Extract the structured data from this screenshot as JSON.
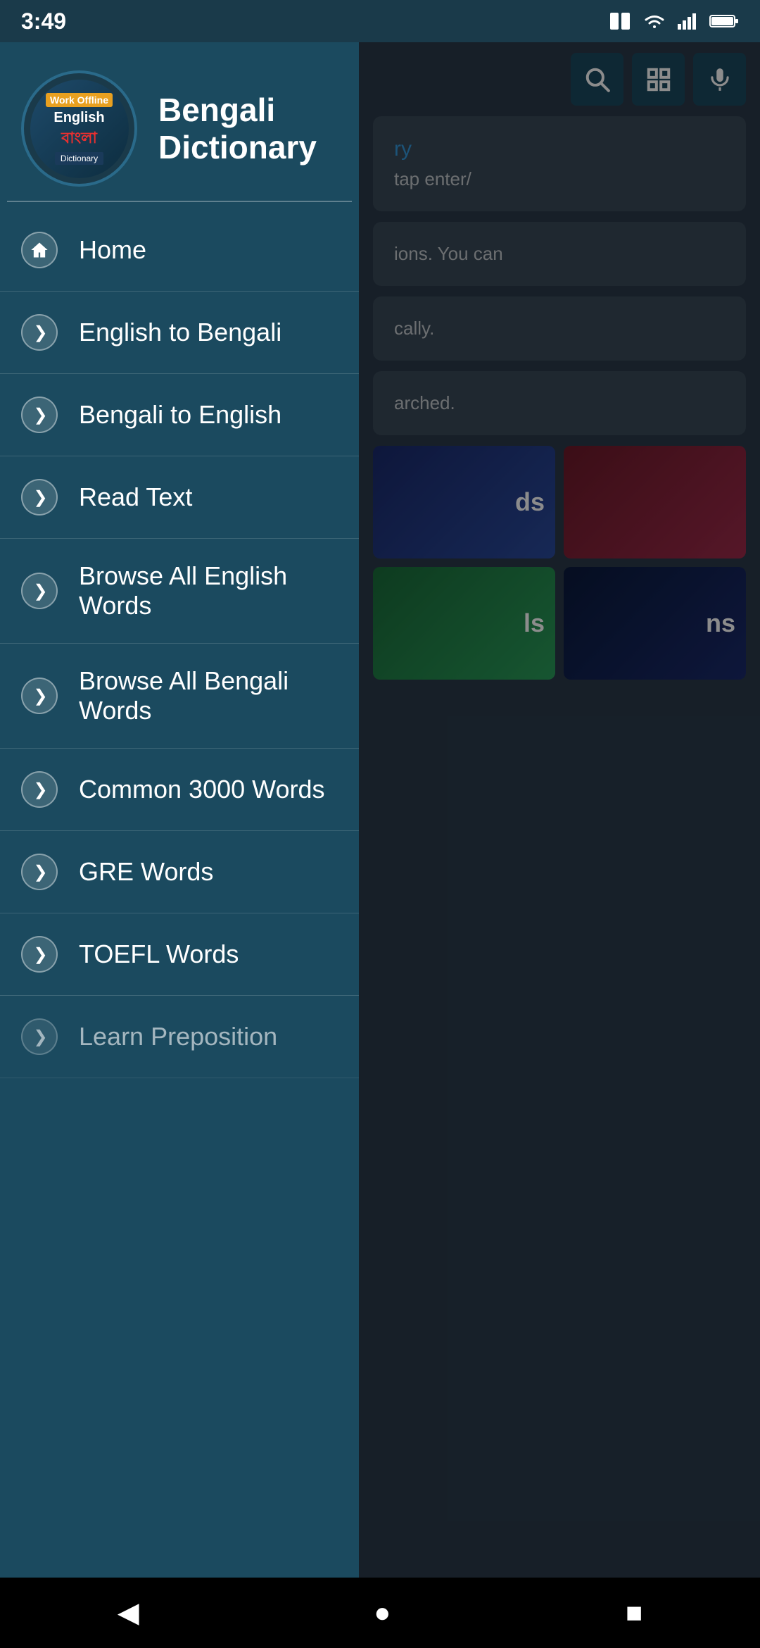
{
  "statusBar": {
    "time": "3:49",
    "icons": [
      "sim-icon",
      "wifi-icon",
      "signal-icon",
      "battery-icon"
    ]
  },
  "drawer": {
    "logo": {
      "workOffline": "Work Offline",
      "english": "English",
      "bangla": "বাংলা",
      "dictionary": "Dictionary"
    },
    "title": "Bengali\nDictionary",
    "navItems": [
      {
        "id": "home",
        "label": "Home",
        "icon": "home"
      },
      {
        "id": "english-to-bengali",
        "label": "English to Bengali",
        "icon": "arrow"
      },
      {
        "id": "bengali-to-english",
        "label": "Bengali to English",
        "icon": "arrow"
      },
      {
        "id": "read-text",
        "label": "Read Text",
        "icon": "arrow"
      },
      {
        "id": "browse-all-english-words",
        "label": "Browse All English Words",
        "icon": "arrow"
      },
      {
        "id": "browse-all-bengali-words",
        "label": "Browse All Bengali Words",
        "icon": "arrow"
      },
      {
        "id": "common-3000-words",
        "label": "Common 3000 Words",
        "icon": "arrow"
      },
      {
        "id": "gre-words",
        "label": "GRE Words",
        "icon": "arrow"
      },
      {
        "id": "toefl-words",
        "label": "TOEFL Words",
        "icon": "arrow"
      },
      {
        "id": "learn-preposition",
        "label": "Learn Preposition",
        "icon": "arrow"
      }
    ]
  },
  "rightPanel": {
    "searchPlaceholder": "",
    "cardText1": "tap enter/",
    "cardText2": "ions. You can",
    "cardText3": "cally.",
    "cardText4": "arched.",
    "cards": [
      {
        "label": "ds",
        "color": "dark-blue"
      },
      {
        "label": "",
        "color": "dark-red"
      },
      {
        "label": "ls",
        "color": "dark-green"
      },
      {
        "label": "ns",
        "color": "dark-navy"
      }
    ]
  },
  "navBar": {
    "backLabel": "◀",
    "homeLabel": "●",
    "recentLabel": "■"
  }
}
